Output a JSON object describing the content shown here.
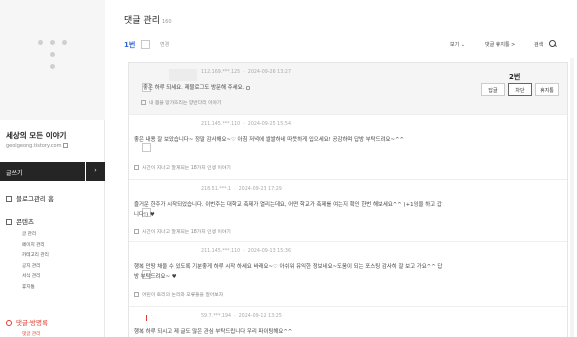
{
  "sidebar": {
    "blog_title": "세상의 모든 이야기",
    "blog_url": "geolgeong.tistory.com",
    "write_label": "글쓰기",
    "write_arrow": "›",
    "home_label": "블로그관리 홈",
    "content_label": "콘텐츠",
    "content_items": [
      "글 관리",
      "페이지 관리",
      "카테고리 관리",
      "공지 관리",
      "서식 관리",
      "휴지통"
    ],
    "comment_label": "댓글·방명록",
    "comment_sub": "댓글 관리"
  },
  "header": {
    "title": "댓글 관리",
    "count": "160"
  },
  "annotations": {
    "one": "1번",
    "two": "2번"
  },
  "toolbar": {
    "state_label": "변경",
    "view_label": "보기 ⌄",
    "filter_label": "댓글 휴지통 >",
    "search_label": "검색"
  },
  "comments": [
    {
      "meta_ip": "112.169.***.125",
      "meta_time": "2024-09-26 13:27",
      "text": "좋은 하루 되세요. 제블로그도 방문해 주세요.",
      "post": "내 몸을 망가뜨리는 양반다리 이야기",
      "actions": [
        "답글",
        "차단",
        "휴지통"
      ]
    },
    {
      "meta_ip": "211.145.***.110",
      "meta_time": "2024-09-25 15:54",
      "text": "좋은 내용 잘 보았습니다~ 정말 감사해요~♡ 아침 저녁에 쌀쌀하네 따뜻하게 입으세요! 공감하며 답방 부탁드려요~^^",
      "post": "시간이 지나고 알게되는 18가지 인생 이야기"
    },
    {
      "meta_ip": "218.51.***.1",
      "meta_time": "2024-09-23 17:29",
      "text": "즐거운 한주가 시작되었습니다. 이번주는 대학교 축제가 열리는데요, 어떤 학교가 축제를 여는지 확인 한번 해보세요^^ (+1잉을 하고 갑니다!) ♥",
      "post": "시간이 지나고 알게되는 18가지 인생 이야기"
    },
    {
      "meta_ip": "211.145.***.110",
      "meta_time": "2024-09-13 15:36",
      "text": "행복 만땅 채울 수 있도록 기분좋게 하루 시작 하세요 바래요~♡ 아쉬워 유익한 정보네요~도움이 되는 포스팅 감사히 잘 보고 가요^^ 답방 부탁드려요~ ♥",
      "post": "어린이 토리의 논리와 오류들을 알아보자"
    },
    {
      "meta_ip": "59.7.***.194",
      "meta_time": "2024-09-12 13:25",
      "text": "행복 하루 되시고 제 글도 많은 관심 부탁드립니다 우리 파이팅해요^^",
      "post": ""
    }
  ]
}
